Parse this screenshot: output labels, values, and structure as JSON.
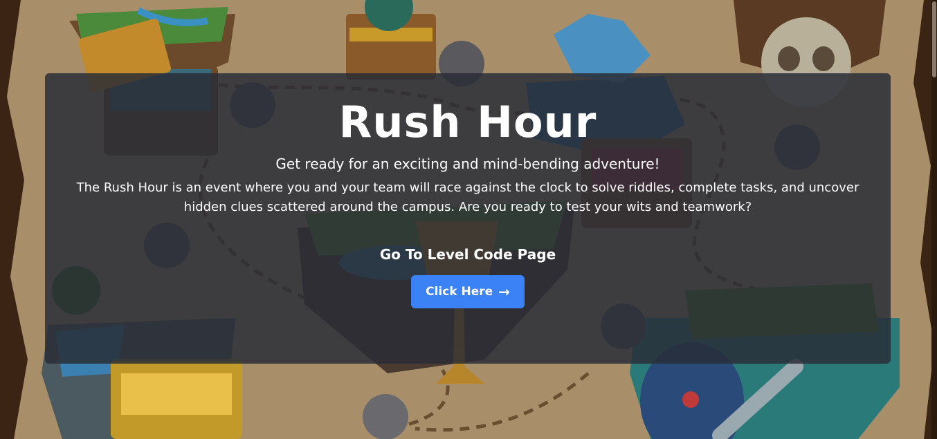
{
  "hero": {
    "title": "Rush Hour",
    "subtitle": "Get ready for an exciting and mind-bending adventure!",
    "description": "The Rush Hour is an event where you and your team will race against the clock to solve riddles, complete tasks, and uncover hidden clues scattered around the campus. Are you ready to test your wits and teamwork?",
    "goto_label": "Go To Level Code Page",
    "button_label": "Click Here",
    "button_icon": "arrow-right-icon",
    "button_arrow": "→"
  },
  "colors": {
    "panel": "#282c36",
    "button": "#3b82f6",
    "parchment": "#bfa27a",
    "map_frame": "#3b2414"
  }
}
